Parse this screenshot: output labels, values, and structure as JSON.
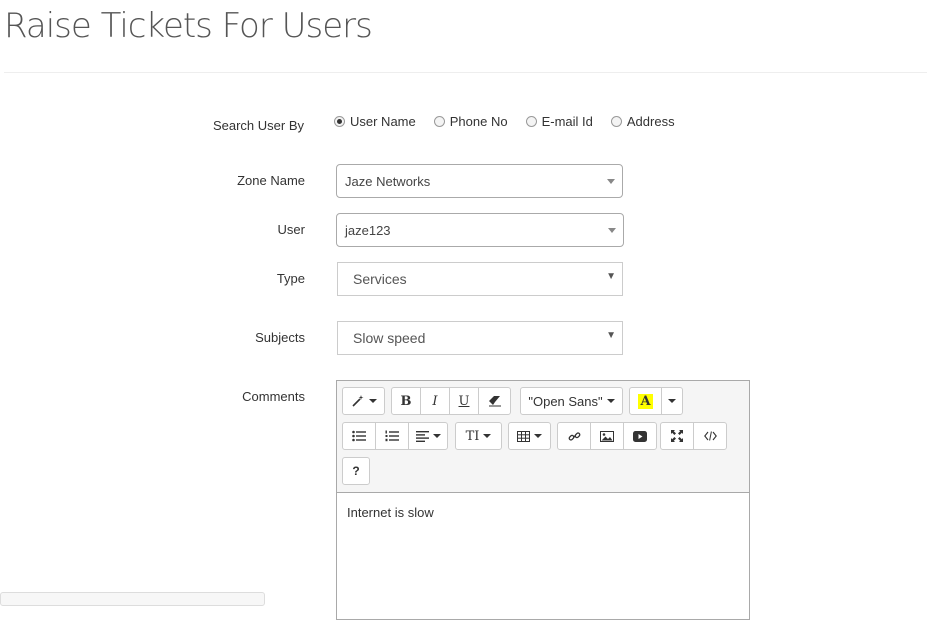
{
  "page": {
    "title": "Raise Tickets For Users"
  },
  "form": {
    "search_by": {
      "label": "Search User By",
      "options": [
        {
          "label": "User Name",
          "checked": true
        },
        {
          "label": "Phone No",
          "checked": false
        },
        {
          "label": "E-mail Id",
          "checked": false
        },
        {
          "label": "Address",
          "checked": false
        }
      ]
    },
    "zone": {
      "label": "Zone Name",
      "value": "Jaze Networks"
    },
    "user": {
      "label": "User",
      "value": "jaze123"
    },
    "type": {
      "label": "Type",
      "value": "Services"
    },
    "subjects": {
      "label": "Subjects",
      "value": "Slow speed"
    },
    "comments": {
      "label": "Comments",
      "font_name": "\"Open Sans\"",
      "bold": "B",
      "italic": "I",
      "underline": "U",
      "font_color": "A",
      "font_size": "TI",
      "help": "?",
      "content": "Internet is slow"
    }
  },
  "colors": {
    "highlight": "#ffff00",
    "border": "#aaaaaa",
    "toolbar_bg": "#f5f5f5"
  }
}
